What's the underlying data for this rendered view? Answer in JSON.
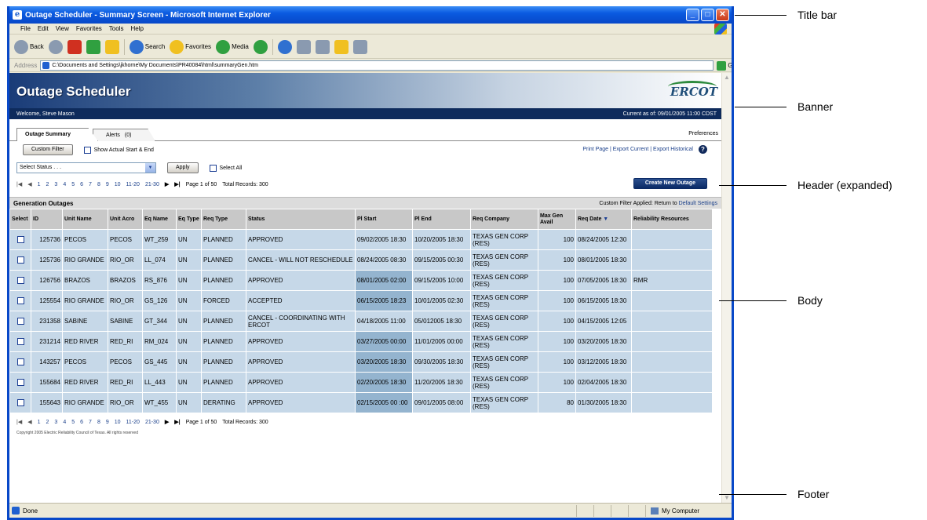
{
  "window": {
    "title": "Outage Scheduler - Summary Screen - Microsoft Internet Explorer"
  },
  "menu": [
    "File",
    "Edit",
    "View",
    "Favorites",
    "Tools",
    "Help"
  ],
  "toolbar": {
    "back": "Back",
    "search": "Search",
    "favorites": "Favorites",
    "media": "Media"
  },
  "address": {
    "label": "Address",
    "url": "C:\\Documents and Settings\\jkhorne\\My Documents\\PR40084\\html\\summaryGen.htm",
    "go": "Go"
  },
  "banner": {
    "title": "Outage Scheduler",
    "logo": "ERCOT"
  },
  "welcome": {
    "user": "Welcome, Steve Mason",
    "current": "Current as of: 09/01/2005 11:00 CDST"
  },
  "tabs": [
    "Outage Summary",
    "Alerts"
  ],
  "tab_alert_icon": "(0)",
  "preferences": "Preferences",
  "controls": {
    "custom_filter": "Custom Filter",
    "show_actual": "Show Actual Start & End",
    "select_status": "Select Status . . .",
    "apply": "Apply",
    "select_all": "Select All",
    "create_new": "Create New Outage"
  },
  "links": {
    "print": "Print Page",
    "export_current": "Export Current",
    "export_historical": "Export Historical",
    "sep": "|"
  },
  "pager": {
    "pages": [
      "1",
      "2",
      "3",
      "4",
      "5",
      "6",
      "7",
      "8",
      "9",
      "10",
      "11-20",
      "21-30"
    ],
    "page_info": "Page 1 of 50",
    "total": "Total Records: 300"
  },
  "grid": {
    "section": "Generation Outages",
    "filter_note": "Custom Filter Applied: Return to",
    "default_link": "Default Settings",
    "columns": [
      "Select",
      "ID",
      "Unit Name",
      "Unit Acro",
      "Eq Name",
      "Eq Type",
      "Req Type",
      "Status",
      "Pl Start",
      "Pl End",
      "Req Company",
      "Max Gen Avail",
      "Req Date",
      "Reliability Resources"
    ],
    "rows": [
      [
        "125736",
        "PECOS",
        "PECOS",
        "WT_259",
        "UN",
        "PLANNED",
        "APPROVED",
        "09/02/2005 18:30",
        "10/20/2005 18:30",
        "TEXAS GEN CORP (RES)",
        "100",
        "08/24/2005 12:30",
        ""
      ],
      [
        "125736",
        "RIO GRANDE",
        "RIO_OR",
        "LL_074",
        "UN",
        "PLANNED",
        "CANCEL - WILL NOT RESCHEDULE",
        "08/24/2005 08:30",
        "09/15/2005 00:30",
        "TEXAS GEN CORP (RES)",
        "100",
        "08/01/2005 18:30",
        ""
      ],
      [
        "126756",
        "BRAZOS",
        "BRAZOS",
        "RS_876",
        "UN",
        "PLANNED",
        "APPROVED",
        "08/01/2005 02:00",
        "09/15/2005 10:00",
        "TEXAS GEN CORP (RES)",
        "100",
        "07/05/2005 18:30",
        "RMR"
      ],
      [
        "125554",
        "RIO GRANDE",
        "RIO_OR",
        "GS_126",
        "UN",
        "FORCED",
        "ACCEPTED",
        "06/15/2005 18:23",
        "10/01/2005 02:30",
        "TEXAS GEN CORP (RES)",
        "100",
        "06/15/2005 18:30",
        ""
      ],
      [
        "231358",
        "SABINE",
        "SABINE",
        "GT_344",
        "UN",
        "PLANNED",
        "CANCEL - COORDINATING WITH ERCOT",
        "04/18/2005 11:00",
        "05/012005 18:30",
        "TEXAS GEN CORP (RES)",
        "100",
        "04/15/2005 12:05",
        ""
      ],
      [
        "231214",
        "RED RIVER",
        "RED_RI",
        "RM_024",
        "UN",
        "PLANNED",
        "APPROVED",
        "03/27/2005 00:00",
        "11/01/2005 00:00",
        "TEXAS GEN CORP (RES)",
        "100",
        "03/20/2005 18:30",
        ""
      ],
      [
        "143257",
        "PECOS",
        "PECOS",
        "GS_445",
        "UN",
        "PLANNED",
        "APPROVED",
        "03/20/2005 18:30",
        "09/30/2005 18:30",
        "TEXAS GEN CORP (RES)",
        "100",
        "03/12/2005 18:30",
        ""
      ],
      [
        "155684",
        "RED RIVER",
        "RED_RI",
        "LL_443",
        "UN",
        "PLANNED",
        "APPROVED",
        "02/20/2005 18:30",
        "11/20/2005 18:30",
        "TEXAS GEN CORP (RES)",
        "100",
        "02/04/2005 18:30",
        ""
      ],
      [
        "155643",
        "RIO GRANDE",
        "RIO_OR",
        "WT_455",
        "UN",
        "DERATING",
        "APPROVED",
        "02/15/2005 00 :00",
        "09/01/2005 08:00",
        "TEXAS GEN CORP (RES)",
        "80",
        "01/30/2005 18:30",
        ""
      ]
    ],
    "highlight_start_rows": [
      2,
      3,
      5,
      6,
      7,
      8
    ]
  },
  "copyright": "Copyright 2005 Electric Reliability Council of Texas. All rights reserved",
  "status": {
    "done": "Done",
    "zone": "My Computer"
  },
  "callouts": [
    "Title bar",
    "Banner",
    "Header (expanded)",
    "Body",
    "Footer"
  ]
}
